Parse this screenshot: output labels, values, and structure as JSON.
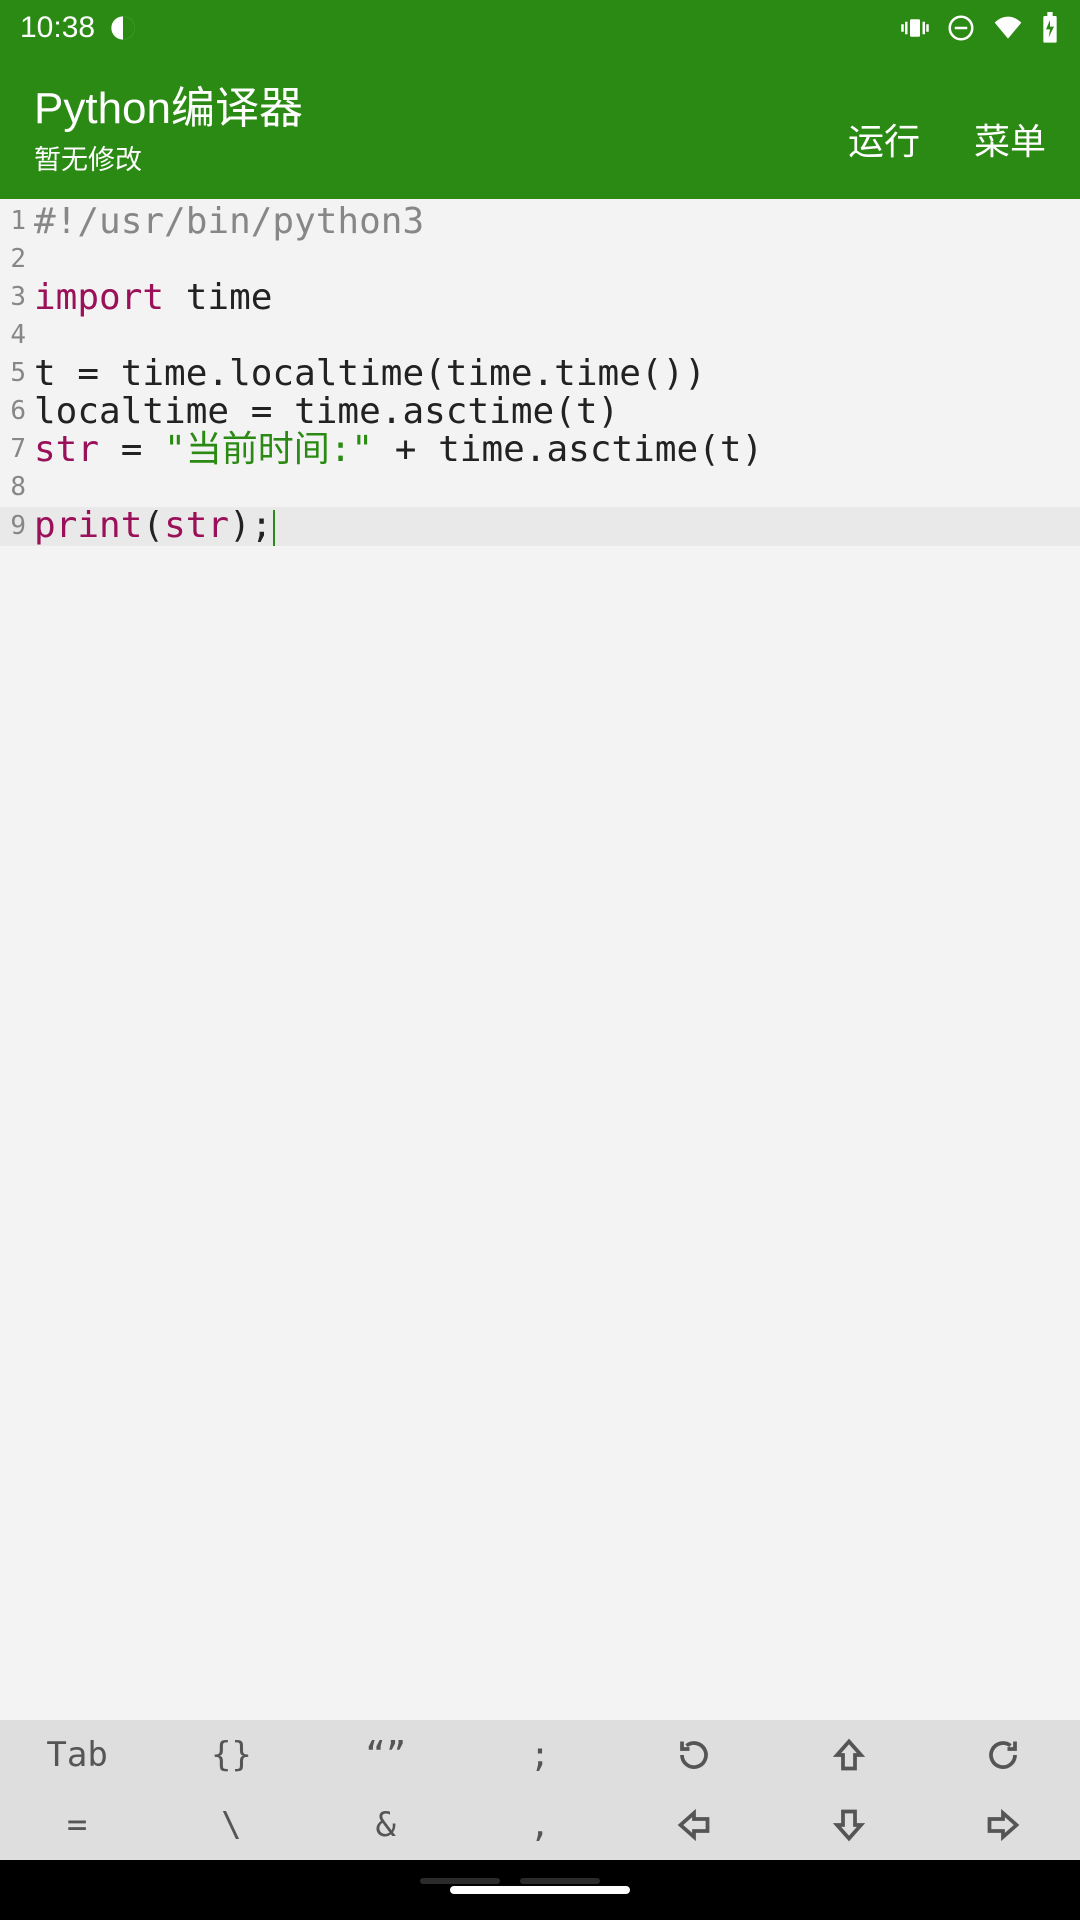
{
  "statusbar": {
    "time": "10:38"
  },
  "header": {
    "title": "Python编译器",
    "subtitle": "暂无修改",
    "run_label": "运行",
    "menu_label": "菜单"
  },
  "code": {
    "line_numbers": [
      "1",
      "2",
      "3",
      "4",
      "5",
      "6",
      "7",
      "8",
      "9"
    ],
    "current_line_index": 8,
    "lines": [
      [
        {
          "t": "comment",
          "s": "#!/usr/bin/python3"
        }
      ],
      [],
      [
        {
          "t": "keyword",
          "s": "import"
        },
        {
          "t": "plain",
          "s": " time"
        }
      ],
      [],
      [
        {
          "t": "plain",
          "s": "t = time.localtime(time.time())"
        }
      ],
      [
        {
          "t": "plain",
          "s": "localtime = time.asctime(t)"
        }
      ],
      [
        {
          "t": "builtin",
          "s": "str"
        },
        {
          "t": "plain",
          "s": " = "
        },
        {
          "t": "string",
          "s": "\"当前时间:\""
        },
        {
          "t": "plain",
          "s": " + time.asctime(t)"
        }
      ],
      [],
      [
        {
          "t": "builtin",
          "s": "print"
        },
        {
          "t": "plain",
          "s": "("
        },
        {
          "t": "builtin",
          "s": "str"
        },
        {
          "t": "plain",
          "s": ");"
        }
      ]
    ]
  },
  "toolbar": {
    "row1": {
      "tab": "Tab",
      "braces": "{}",
      "quotes": "“”",
      "semicolon": ";"
    },
    "row2": {
      "equals": "=",
      "backslash": "\\",
      "ampersand": "&",
      "comma": ","
    }
  }
}
